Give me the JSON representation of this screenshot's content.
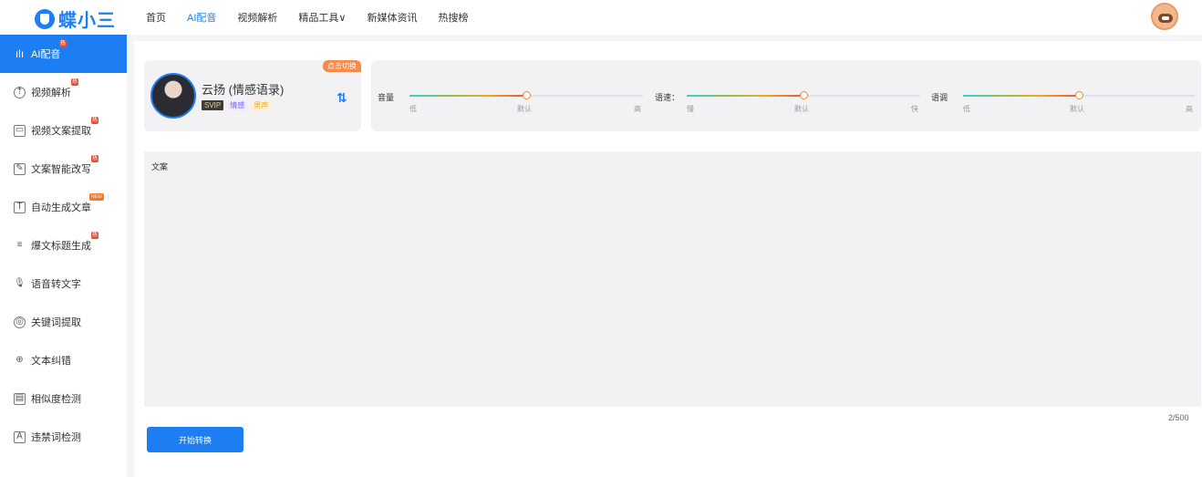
{
  "brand": {
    "logo_text": "蝶小三",
    "accent_color": "#1c7ef2"
  },
  "nav": {
    "items": [
      {
        "label": "首页",
        "active": false
      },
      {
        "label": "AI配音",
        "active": true
      },
      {
        "label": "视频解析",
        "active": false
      },
      {
        "label": "精品工具∨",
        "active": false
      },
      {
        "label": "新媒体资讯",
        "active": false
      },
      {
        "label": "热搜榜",
        "active": false
      }
    ]
  },
  "sidebar": {
    "items": [
      {
        "label": "AI配音",
        "icon": "waveform-icon",
        "badge": "热",
        "active": true
      },
      {
        "label": "视频解析",
        "icon": "cloud-icon",
        "badge": "热"
      },
      {
        "label": "视频文案提取",
        "icon": "video-icon",
        "badge": "热"
      },
      {
        "label": "文案智能改写",
        "icon": "edit-icon",
        "badge": "热"
      },
      {
        "label": "自动生成文章",
        "icon": "text-icon",
        "badge": "NEW"
      },
      {
        "label": "爆文标题生成",
        "icon": "title-icon",
        "badge": "热"
      },
      {
        "label": "语音转文字",
        "icon": "microphone-icon",
        "badge": ""
      },
      {
        "label": "关键词提取",
        "icon": "target-icon",
        "badge": ""
      },
      {
        "label": "文本纠错",
        "icon": "lock-icon",
        "badge": ""
      },
      {
        "label": "相似度检测",
        "icon": "image-icon",
        "badge": ""
      },
      {
        "label": "违禁词检测",
        "icon": "alert-icon",
        "badge": ""
      }
    ]
  },
  "voice": {
    "name": "云扬 (情感语录)",
    "tags": [
      "SVIP",
      "情感",
      "男声"
    ],
    "switch_label": "点击切换"
  },
  "sliders": [
    {
      "label": "音量",
      "min_label": "低",
      "default_label": "默认",
      "max_label": "高",
      "value": 0.5
    },
    {
      "label": "语速：",
      "min_label": "慢",
      "default_label": "默认",
      "max_label": "快",
      "value": 0.5
    },
    {
      "label": "语调",
      "min_label": "低",
      "default_label": "默认",
      "max_label": "高",
      "value": 0.5
    }
  ],
  "editor": {
    "label": "文案",
    "value": "",
    "counter": "2/500"
  },
  "actions": {
    "start_label": "开始转换"
  }
}
